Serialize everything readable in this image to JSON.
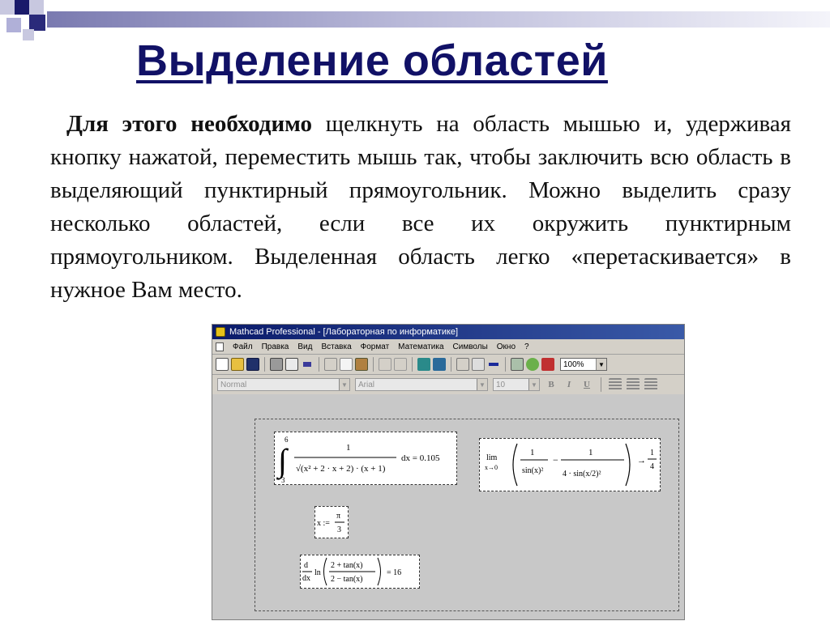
{
  "slide": {
    "title": "Выделение областей",
    "body_bold": "Для этого необходимо",
    "body_rest": " щелкнуть на область мышью и, удерживая кнопку нажатой, переместить мышь так, чтобы заключить всю область в выделяющий пунктирный прямоугольник. Можно выделить сразу несколько областей, если все их окружить пунктирным прямоугольником. Выделенная область легко «перетаскивается» в нужное Вам место."
  },
  "mathcad": {
    "window_title": "Mathcad Professional - [Лабораторная по информатике]",
    "menu": [
      "Файл",
      "Правка",
      "Вид",
      "Вставка",
      "Формат",
      "Математика",
      "Символы",
      "Окно",
      "?"
    ],
    "zoom": "100%",
    "style_select": "Normal",
    "font_select": "Arial",
    "size_select": "10",
    "format_buttons": [
      "B",
      "I",
      "U"
    ],
    "regions": {
      "integral": {
        "upper": "6",
        "lower": "3",
        "numerator": "1",
        "denominator": "√(x² + 2 · x + 2) · (x + 1)",
        "result": "dx = 0.105"
      },
      "limit": {
        "lim": "lim",
        "under": "x→0",
        "term1_num": "1",
        "term1_den": "sin(x)²",
        "minus": "−",
        "term2_num": "1",
        "term2_den": "4 · sin(x/2)²",
        "arrow": "→",
        "result_num": "1",
        "result_den": "4"
      },
      "assignment": {
        "lhs": "x :=",
        "num": "π",
        "den": "3"
      },
      "derivative": {
        "d_num": "d",
        "d_den": "dx",
        "ln": "ln",
        "frac_num": "2 + tan(x)",
        "frac_den": "2 − tan(x)",
        "result": "= 16"
      }
    }
  },
  "colors": {
    "title": "#111166",
    "titlebar_start": "#0a1a6a",
    "titlebar_end": "#3a5aa8",
    "worksheet_bg": "#c8c8c8"
  }
}
